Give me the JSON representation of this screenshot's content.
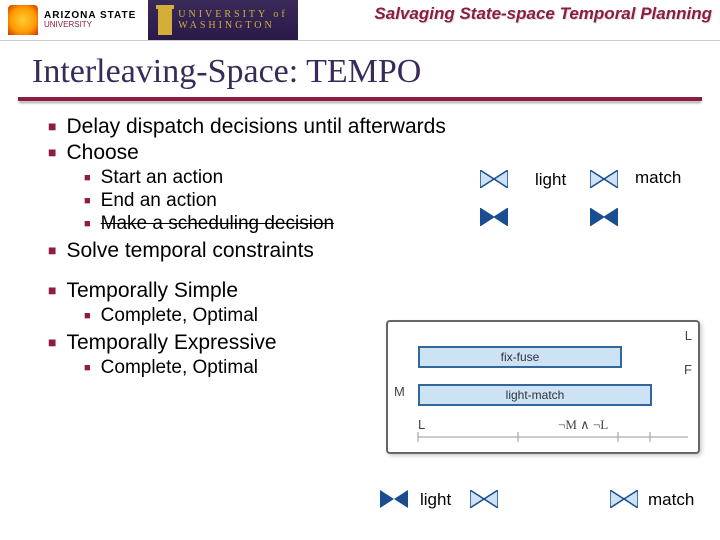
{
  "header": {
    "asu_line1": "ARIZONA STATE",
    "asu_line2": "UNIVERSITY",
    "uw_line1": "UNIVERSITY of",
    "uw_line2": "WASHINGTON",
    "subtitle": "Salvaging State-space Temporal Planning"
  },
  "title": "Interleaving-Space: TEMPO",
  "bullets": {
    "b1": "Delay dispatch decisions until afterwards",
    "b2": "Choose",
    "b2_1": "Start an action",
    "b2_2": "End an action",
    "b2_3": "Make a scheduling decision",
    "b3": "Solve temporal constraints",
    "b4": "Temporally Simple",
    "b4_1": "Complete, Optimal",
    "b5": "Temporally Expressive",
    "b5_1": "Complete, Optimal"
  },
  "diagram": {
    "light": "light",
    "match": "match",
    "fix_fuse": "fix-fuse",
    "light_match": "light-match",
    "L": "L",
    "F": "F",
    "M": "M",
    "notM_notL": "¬M ∧ ¬L"
  }
}
